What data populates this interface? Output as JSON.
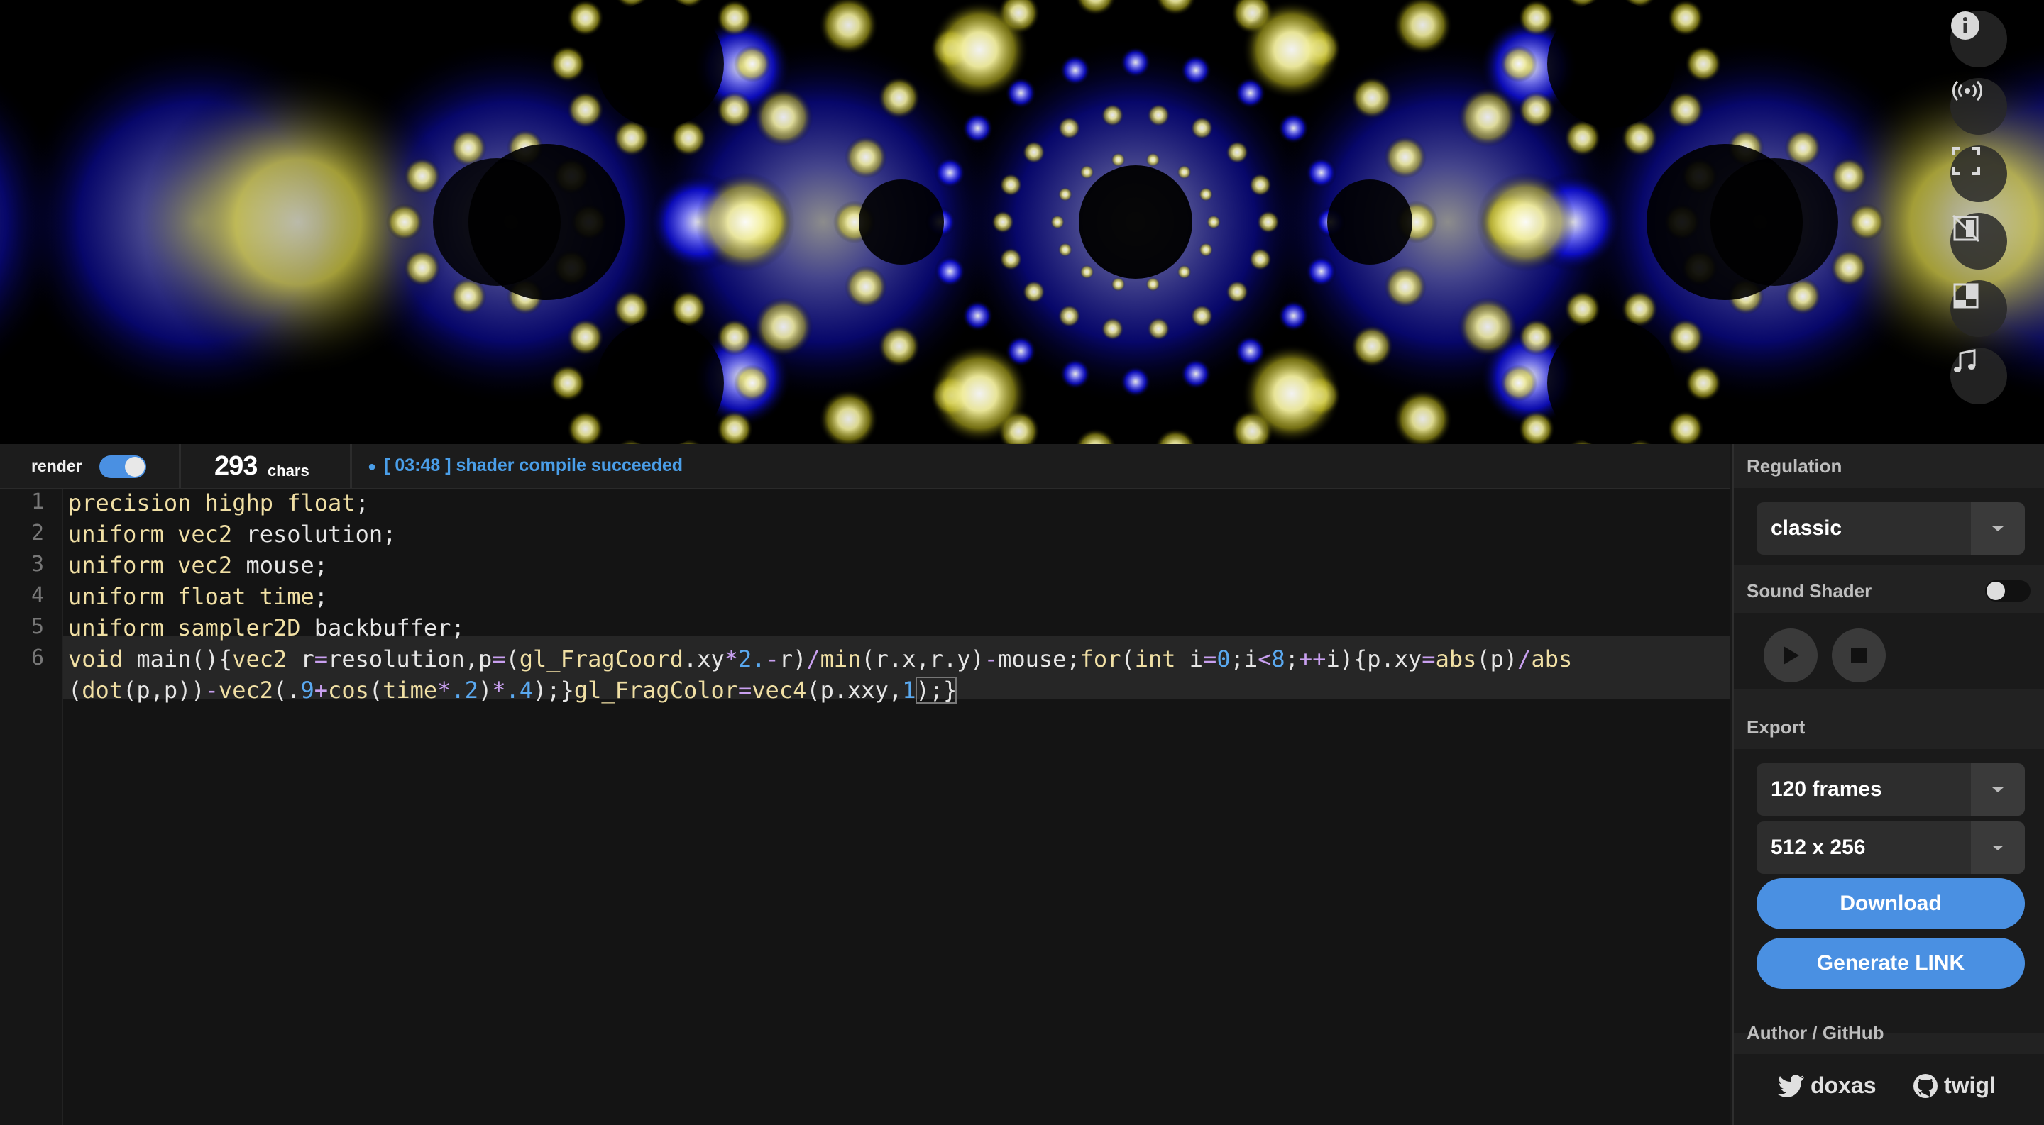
{
  "sidebar_icons": [
    {
      "name": "info-icon",
      "glyph": "i"
    },
    {
      "name": "broadcast-icon"
    },
    {
      "name": "fullscreen-icon"
    },
    {
      "name": "hide-editor-icon"
    },
    {
      "name": "layout-icon"
    },
    {
      "name": "music-note-icon",
      "glyph": "♫"
    }
  ],
  "toolbar": {
    "render_label": "render",
    "render_enabled": true,
    "char_count": "293",
    "char_unit": "chars",
    "status_time": "[ 03:48 ]",
    "status_message": "shader compile succeeded"
  },
  "editor": {
    "line_numbers": [
      "1",
      "2",
      "3",
      "4",
      "5",
      "6"
    ],
    "lines": [
      "precision highp float;",
      "uniform vec2 resolution;",
      "uniform vec2 mouse;",
      "uniform float time;",
      "uniform sampler2D backbuffer;",
      "void main(){vec2 r=resolution,p=(gl_FragCoord.xy*2.-r)/min(r.x,r.y)-mouse;for(int i=0;i<8;++i){p.xy=abs(p)/abs(dot(p,p))-vec2(.9+cos(time*.2)*.4);}gl_FragColor=vec4(p.xxy,1);}"
    ]
  },
  "panel": {
    "regulation_title": "Regulation",
    "regulation_value": "classic",
    "sound_title": "Sound Shader",
    "sound_enabled": false,
    "export_title": "Export",
    "frames_value": "120 frames",
    "size_value": "512 x 256",
    "download_label": "Download",
    "link_label": "Generate LINK",
    "author_title": "Author / GitHub",
    "author_twitter": "doxas",
    "author_github": "twigl"
  },
  "colors": {
    "accent": "#4a90e2",
    "status": "#4a9ee8",
    "keyword": "#f0dfa4",
    "number": "#5aa9f0"
  }
}
